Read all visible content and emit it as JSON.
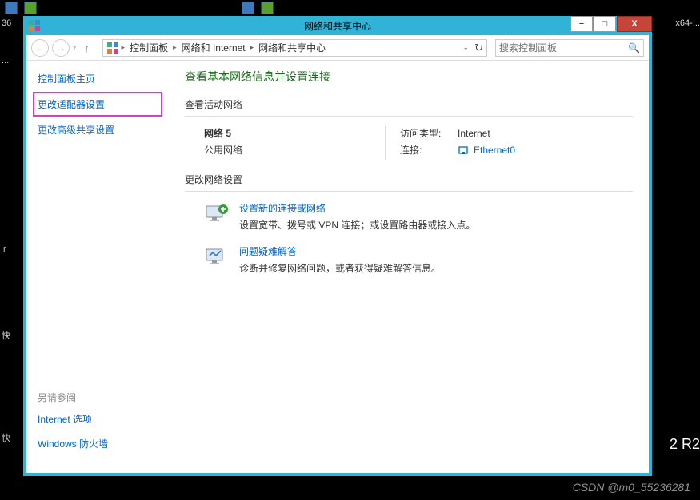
{
  "desktop": {
    "left_label": "36",
    "right_label": "x64-...",
    "bottom_right": "2 R2",
    "watermark": "CSDN @m0_55236281",
    "edge_marks": [
      "...",
      "r",
      "快",
      "快"
    ]
  },
  "window": {
    "title": "网络和共享中心",
    "controls": {
      "min": "−",
      "max": "□",
      "close": "X"
    }
  },
  "nav": {
    "breadcrumb": [
      "控制面板",
      "网络和 Internet",
      "网络和共享中心"
    ],
    "search_placeholder": "搜索控制面板"
  },
  "sidebar": {
    "home": "控制面板主页",
    "adapter": "更改适配器设置",
    "advanced": "更改高级共享设置",
    "see_also_title": "另请参阅",
    "see_also": [
      "Internet 选项",
      "Windows 防火墙"
    ]
  },
  "main": {
    "heading": "查看基本网络信息并设置连接",
    "active_networks_title": "查看活动网络",
    "network": {
      "name": "网络 5",
      "type": "公用网络",
      "access_label": "访问类型:",
      "access_value": "Internet",
      "conn_label": "连接:",
      "conn_value": "Ethernet0"
    },
    "change_settings_title": "更改网络设置",
    "items": [
      {
        "link": "设置新的连接或网络",
        "desc": "设置宽带、拨号或 VPN 连接；或设置路由器或接入点。"
      },
      {
        "link": "问题疑难解答",
        "desc": "诊断并修复网络问题，或者获得疑难解答信息。"
      }
    ]
  }
}
